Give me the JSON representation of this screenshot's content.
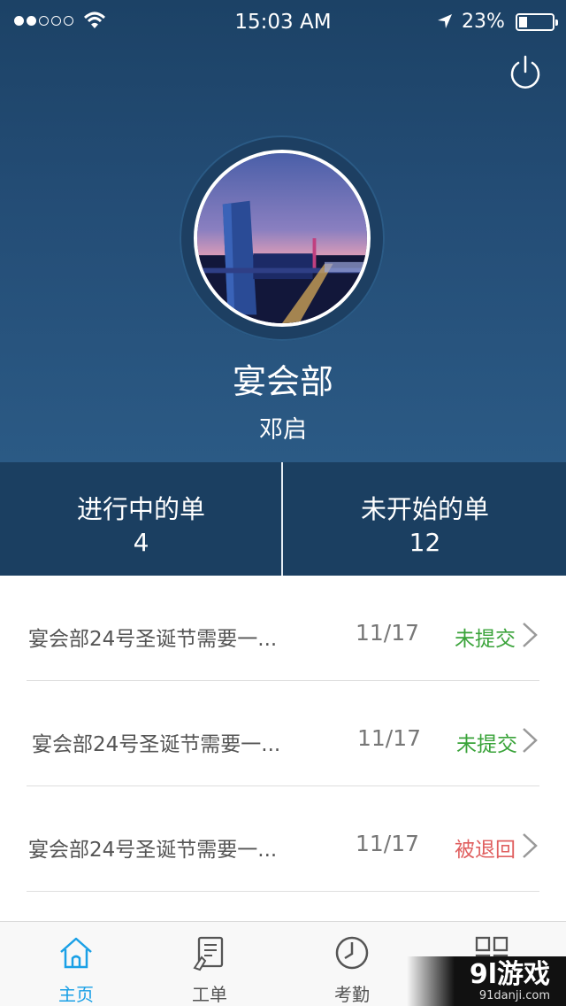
{
  "status_bar": {
    "time": "15:03 AM",
    "battery": "23%",
    "signal_bars": 2,
    "battery_level": 0.23
  },
  "profile": {
    "department": "宴会部",
    "name": "邓启"
  },
  "stats": {
    "in_progress_label": "进行中的单",
    "in_progress_count": "4",
    "not_started_label": "未开始的单",
    "not_started_count": "12"
  },
  "orders": [
    {
      "title": "宴会部24号圣诞节需要一...",
      "date": "11/17",
      "status": "未提交",
      "status_color": "#3aa33a"
    },
    {
      "title": "宴会部24号圣诞节需要一...",
      "date": "11/17",
      "status": "未提交",
      "status_color": "#3aa33a"
    },
    {
      "title": "宴会部24号圣诞节需要一...",
      "date": "11/17",
      "status": "被退回",
      "status_color": "#e06060"
    }
  ],
  "tabbar": {
    "tabs": [
      {
        "label": "主页",
        "icon": "home-icon"
      },
      {
        "label": "工单",
        "icon": "work-order-icon"
      },
      {
        "label": "考勤",
        "icon": "clock-icon"
      },
      {
        "label": "",
        "icon": "grid-icon"
      }
    ]
  },
  "watermark": {
    "brand": "9l游戏",
    "site": "91danji.com"
  },
  "colors": {
    "header_top": "#1c4266",
    "header_bottom": "#2b5a85",
    "stats_bg": "#1b3f61",
    "active_tab": "#1aa0e6",
    "status_pending": "#3aa33a",
    "status_returned": "#e06060"
  }
}
